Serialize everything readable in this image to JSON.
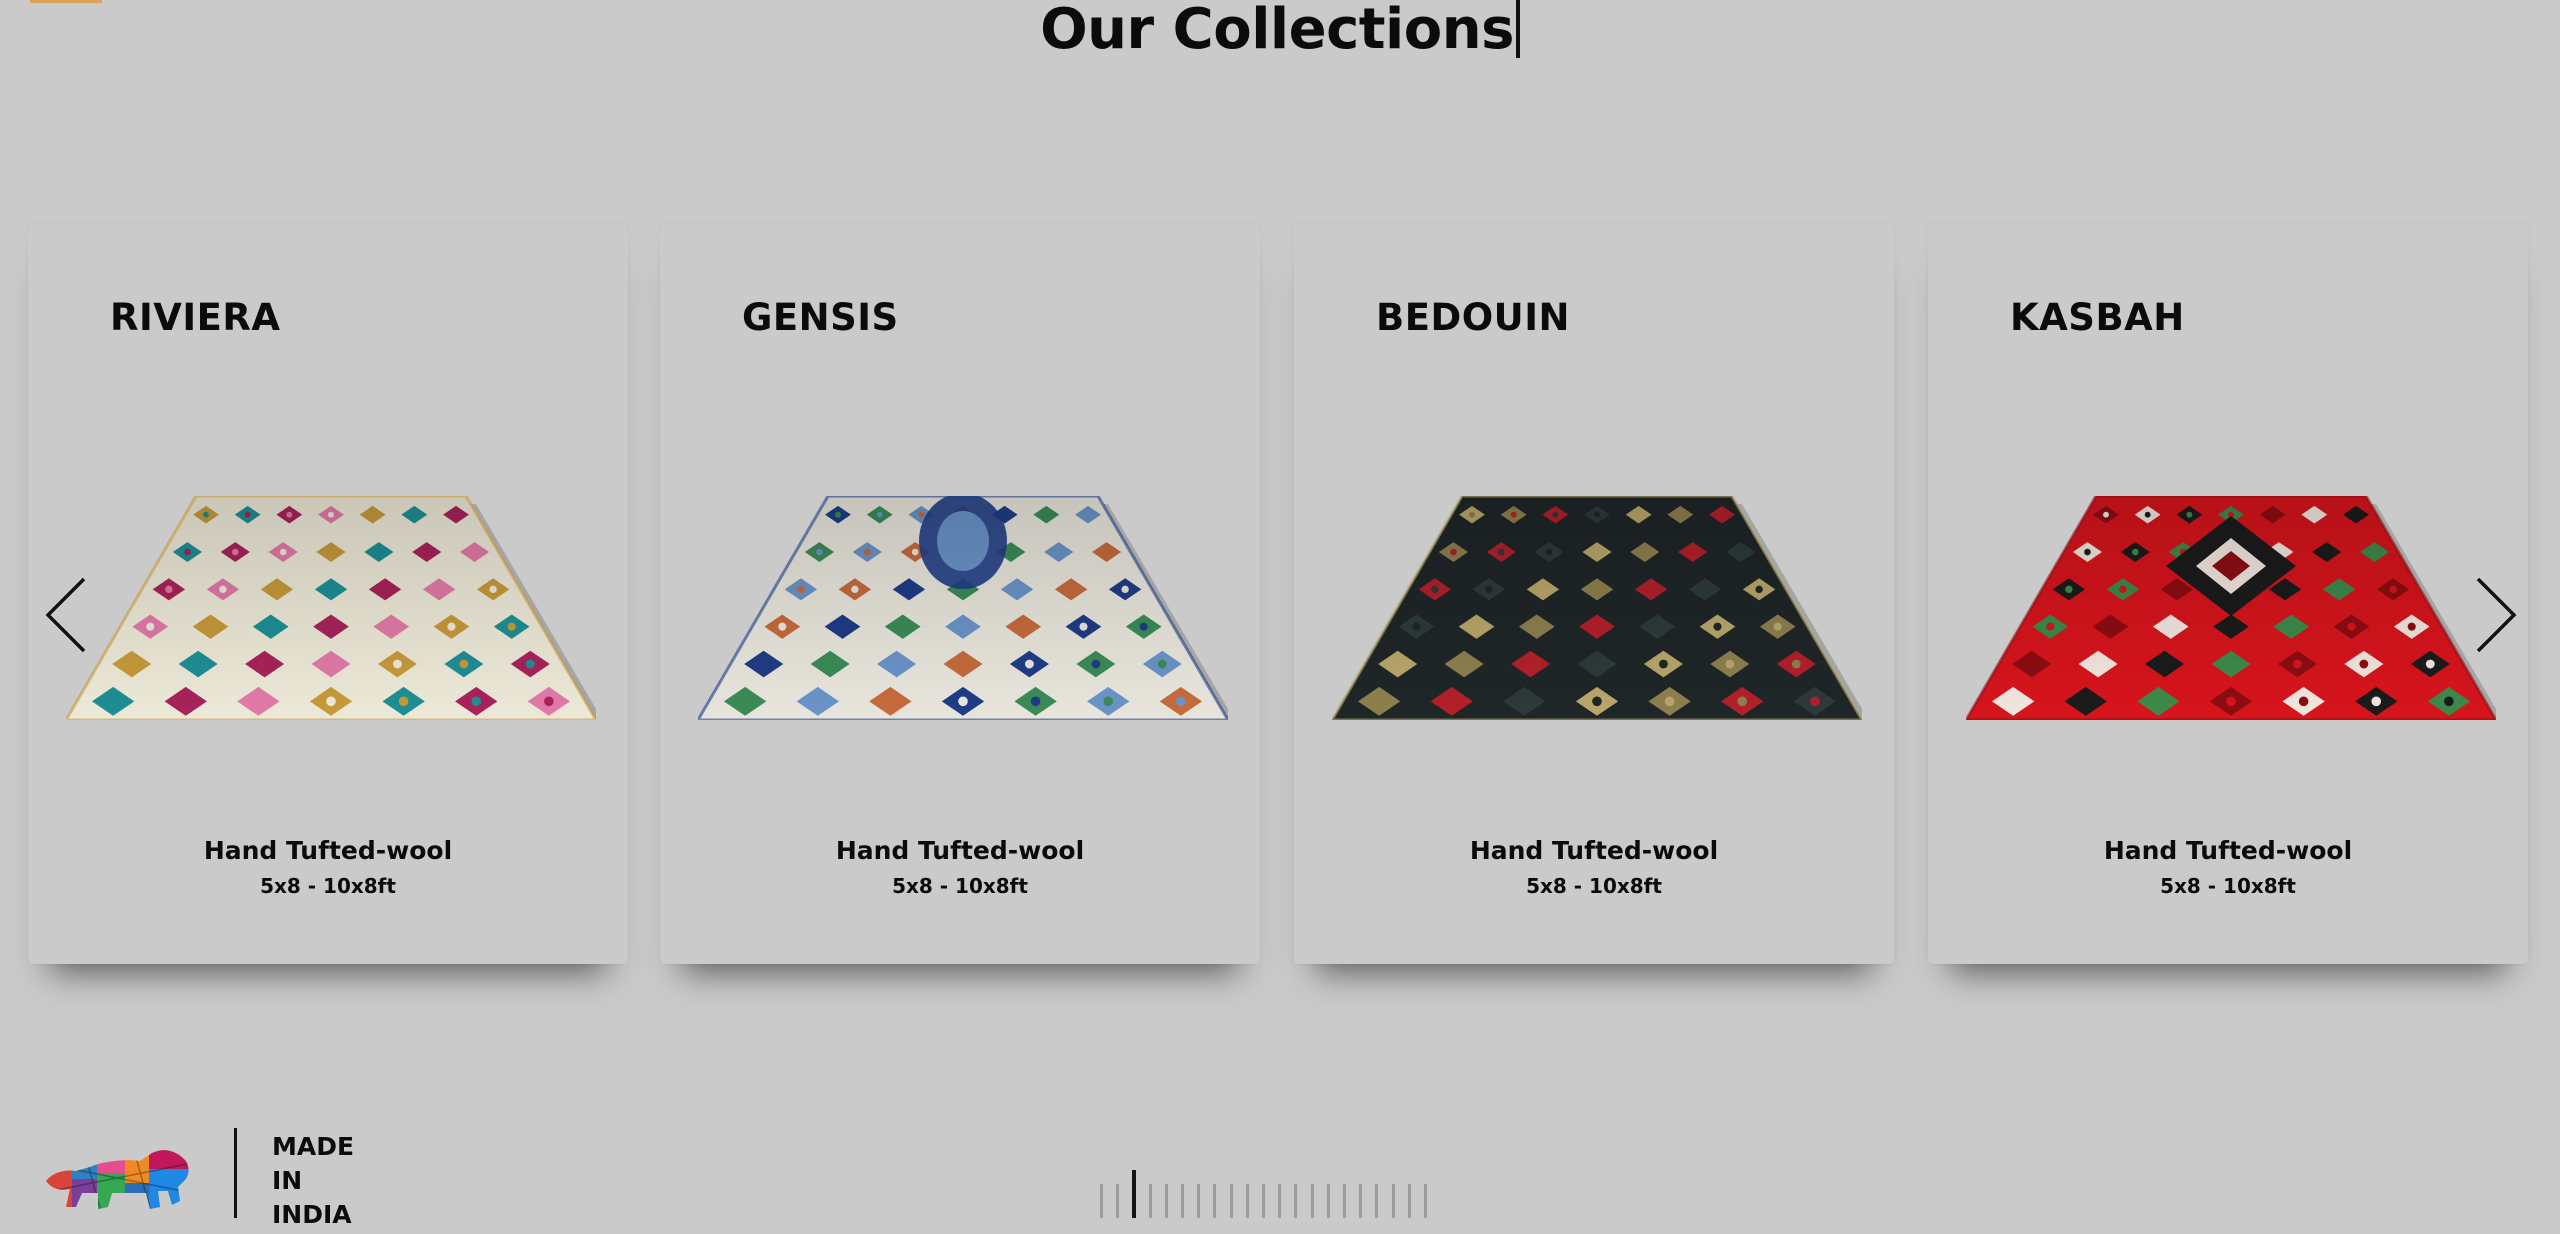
{
  "page": {
    "title": "Our Collections",
    "accent_color": "#d9a35a",
    "background_color": "#c9cac9"
  },
  "collections": [
    {
      "name": "RIVIERA",
      "material": "Hand Tufted-wool",
      "size": "5x8 - 10x8ft",
      "colors": [
        "#ede9d8",
        "#c79a3a",
        "#1d8f95",
        "#a8235a",
        "#e27aa8"
      ]
    },
    {
      "name": "GENSIS",
      "material": "Hand Tufted-wool",
      "size": "5x8 - 10x8ft",
      "colors": [
        "#e8e6dc",
        "#1f3c86",
        "#3b8b57",
        "#6a94c8",
        "#c66b3c"
      ]
    },
    {
      "name": "BEDOUIN",
      "material": "Hand Tufted-wool",
      "size": "5x8 - 10x8ft",
      "colors": [
        "#1f2628",
        "#b9a66a",
        "#8e7f4e",
        "#b3202a",
        "#2e3a3a"
      ]
    },
    {
      "name": "KASBAH",
      "material": "Hand Tufted-wool",
      "size": "5x8 - 10x8ft",
      "colors": [
        "#d7141c",
        "#8c0d12",
        "#f2e6df",
        "#1b1b1b",
        "#3d8a4a"
      ]
    }
  ],
  "navigation": {
    "prev_icon": "chevron-left-icon",
    "next_icon": "chevron-right-icon"
  },
  "brand": {
    "line1": "MADE",
    "line2": "IN",
    "line3": "INDIA",
    "logo_icon": "make-in-india-lion-icon"
  },
  "pager": {
    "slide_count": 21,
    "active_index": 2,
    "active_color": "#141414",
    "inactive_color": "#9c9d9c"
  }
}
